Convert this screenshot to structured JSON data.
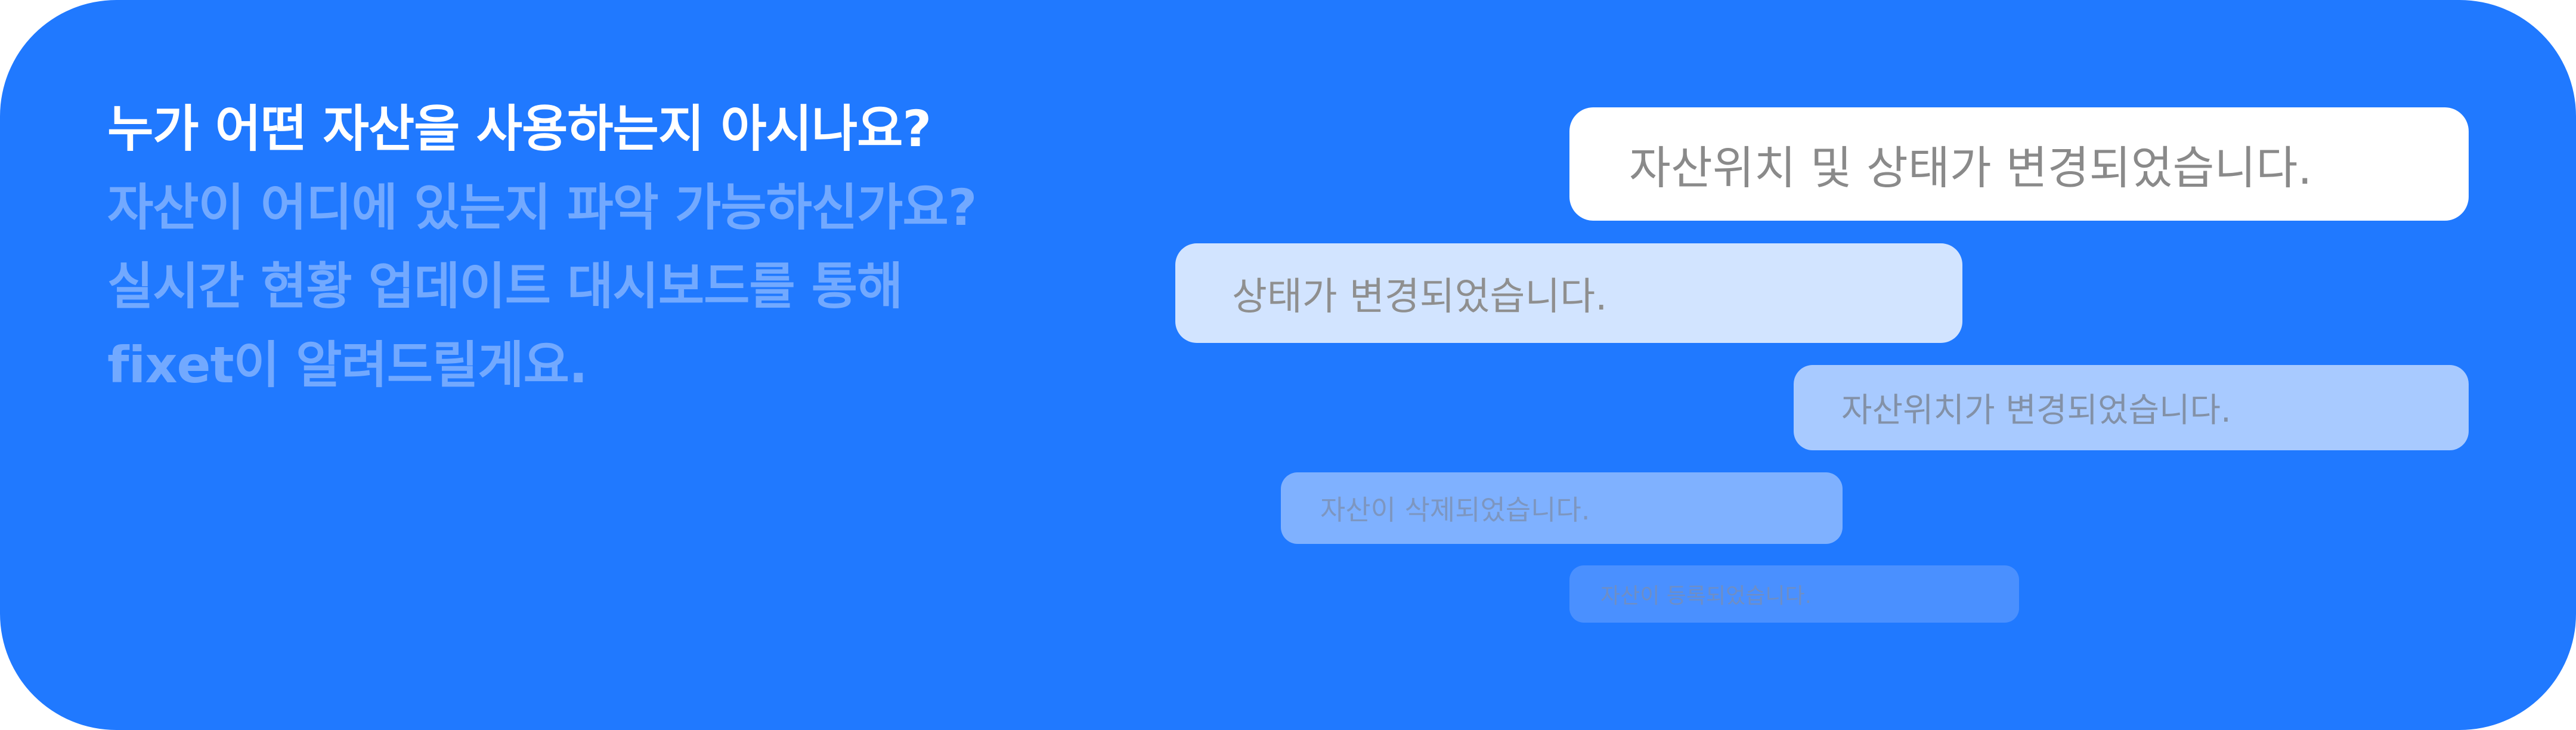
{
  "colors": {
    "background": "#2079ff",
    "headline_primary": "#ffffff",
    "headline_muted": "#72a9ff"
  },
  "headline": {
    "line1": "누가 어떤 자산을 사용하는지 아시나요?",
    "line2": "자산이 어디에 있는지 파악 가능하신가요?",
    "line3": "실시간 현황 업데이트 대시보드를 통해",
    "line4": "fixet이 알려드릴게요."
  },
  "notifications": [
    {
      "text": "자산위치 및 상태가 변경되었습니다."
    },
    {
      "text": "상태가 변경되었습니다."
    },
    {
      "text": "자산위치가 변경되었습니다."
    },
    {
      "text": "자산이 삭제되었습니다."
    },
    {
      "text": "자산이 등록되었습니다."
    }
  ]
}
